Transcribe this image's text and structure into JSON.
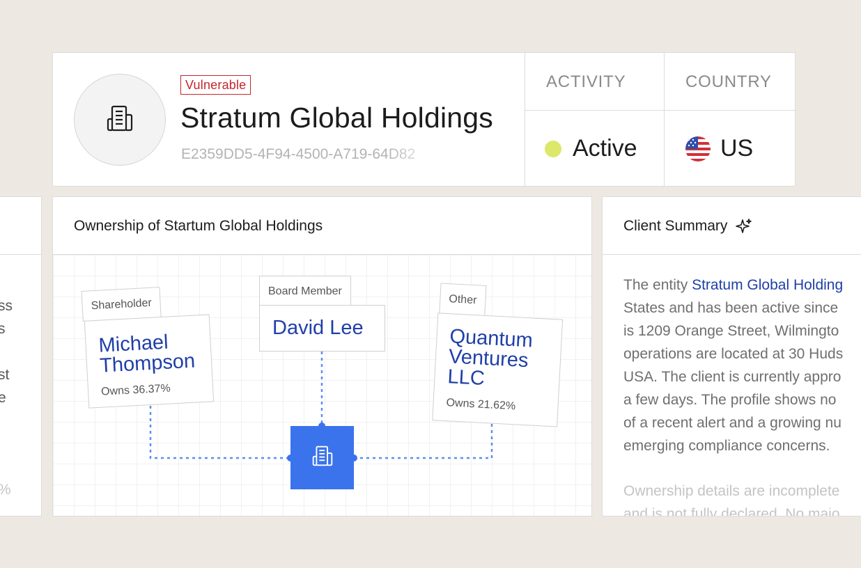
{
  "entity": {
    "status_badge": "Vulnerable",
    "name": "Stratum Global Holdings",
    "id": "E2359DD5-4F94-4500-A719-64D82"
  },
  "activity": {
    "label": "ACTIVITY",
    "value": "Active",
    "status_color": "#dbe86a"
  },
  "country": {
    "label": "COUNTRY",
    "value": "US"
  },
  "left_panel": {
    "fragments": [
      "ss",
      "s",
      "st",
      "e",
      "%"
    ]
  },
  "ownership": {
    "title": "Ownership of Startum Global Holdings",
    "nodes": [
      {
        "role": "Shareholder",
        "name_lines": [
          "Michael",
          "Thompson"
        ],
        "owns": "Owns 36.37%"
      },
      {
        "role": "Board Member",
        "name_lines": [
          "David Lee"
        ]
      },
      {
        "role": "Other",
        "name_lines": [
          "Quantum",
          "Ventures",
          "LLC"
        ],
        "owns": "Owns 21.62%"
      }
    ],
    "connector_color": "#5b8def",
    "center_color": "#3a73ec"
  },
  "summary": {
    "title": "Client Summary",
    "lines": [
      [
        "The entity ",
        "Stratum Global Holding"
      ],
      [
        "States and has been active since",
        ""
      ],
      [
        "is 1209 Orange Street, Wilmingto",
        ""
      ],
      [
        "operations are located at 30 Huds",
        ""
      ],
      [
        "USA. The client is currently appro",
        ""
      ],
      [
        "a few days. The profile shows no",
        ""
      ],
      [
        "of a recent alert and a growing nu",
        ""
      ],
      [
        "emerging compliance concerns.",
        ""
      ]
    ],
    "lines2": [
      "Ownership details are incomplete",
      "and is not fully declared. No majo"
    ]
  },
  "colors": {
    "accent": "#1f3fa8",
    "danger": "#c8242b",
    "background": "#eee8e3"
  }
}
